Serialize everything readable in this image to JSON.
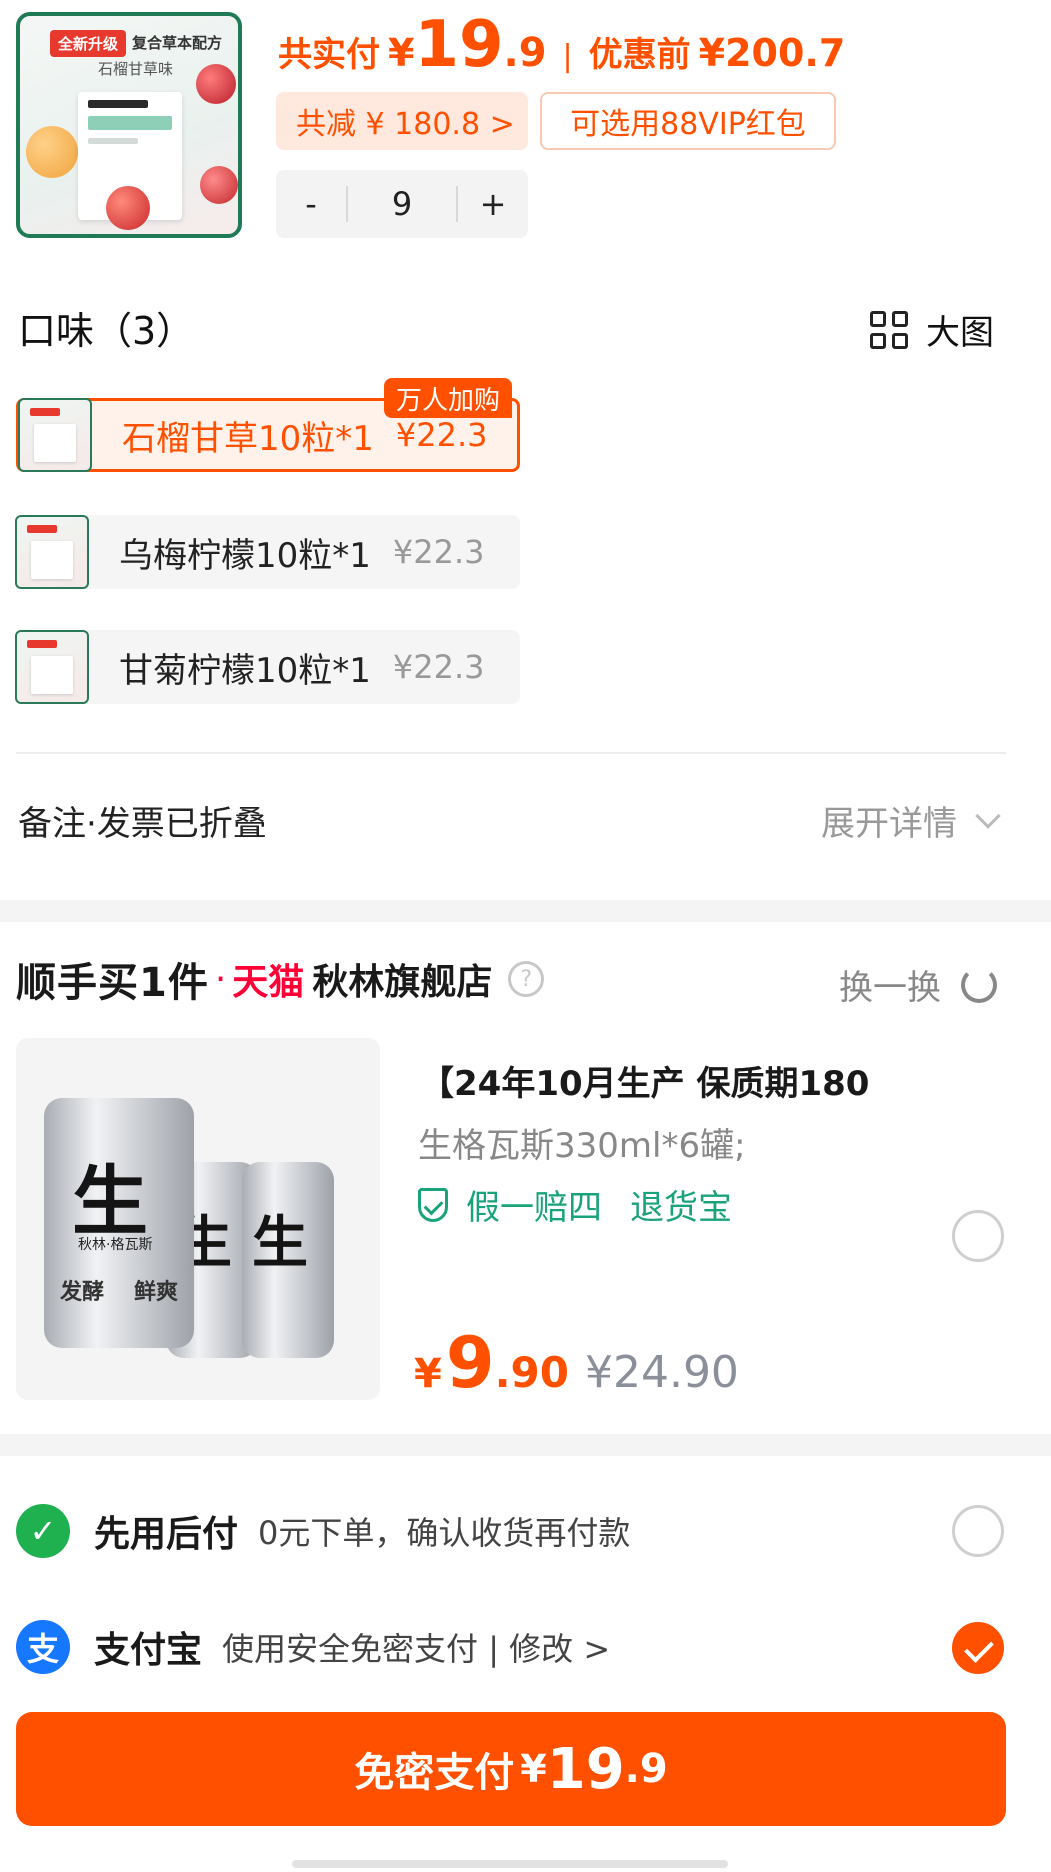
{
  "summary": {
    "thumb_tag": "全新升级",
    "thumb_line1": "复合草本配方",
    "thumb_line2": "石榴甘草味",
    "paid_label": "共实付",
    "paid_yen": "¥",
    "paid_int": "19",
    "paid_dec": ".9",
    "separator": "|",
    "before_label": "优惠前",
    "before_value": "¥200.7",
    "discount_text": "共减 ¥ 180.8 >",
    "vip_text": "可选用88VIP红包",
    "qty_minus": "-",
    "qty_value": "9",
    "qty_plus": "+"
  },
  "flavor": {
    "title": "口味（3）",
    "bigview_label": "大图",
    "badge": "万人加购",
    "options": [
      {
        "name": "石榴甘草10粒*1",
        "price": "¥22.3",
        "selected": true
      },
      {
        "name": "乌梅柠檬10粒*1",
        "price": "¥22.3",
        "selected": false
      },
      {
        "name": "甘菊柠檬10粒*1",
        "price": "¥22.3",
        "selected": false
      }
    ]
  },
  "remark": {
    "label": "备注·发票已折叠",
    "expand_label": "展开详情"
  },
  "addon": {
    "title": "顺手买1件",
    "dot": "·",
    "platform": "天猫",
    "store": "秋林旗舰店",
    "help": "?",
    "swap_label": "换一换",
    "product": {
      "img_char": "生",
      "img_brand": "秋林·格瓦斯",
      "img_fer": "发酵",
      "img_fresh": "鲜爽",
      "title": "【24年10月生产 保质期180",
      "subtitle": "生格瓦斯330ml*6罐;",
      "guarantee1": "假一赔四",
      "guarantee2": "退货宝",
      "price_yen": "¥",
      "price_int": "9",
      "price_dec": ".90",
      "orig_price": "¥24.90",
      "selected": false
    }
  },
  "payment": {
    "methods": [
      {
        "icon": "✓",
        "title": "先用后付",
        "desc": "0元下单，确认收货再付款",
        "selected": false,
        "color": "#1fb14f"
      },
      {
        "icon": "支",
        "title": "支付宝",
        "desc": "使用安全免密支付 | 修改 >",
        "selected": true,
        "color": "#1677ff"
      }
    ],
    "button_label": "免密支付",
    "button_yen": "¥",
    "button_int": "19",
    "button_dec": ".9"
  },
  "colors": {
    "accent": "#ff5000",
    "tmall_red": "#ff0036",
    "guarantee_green": "#1aa37a"
  }
}
